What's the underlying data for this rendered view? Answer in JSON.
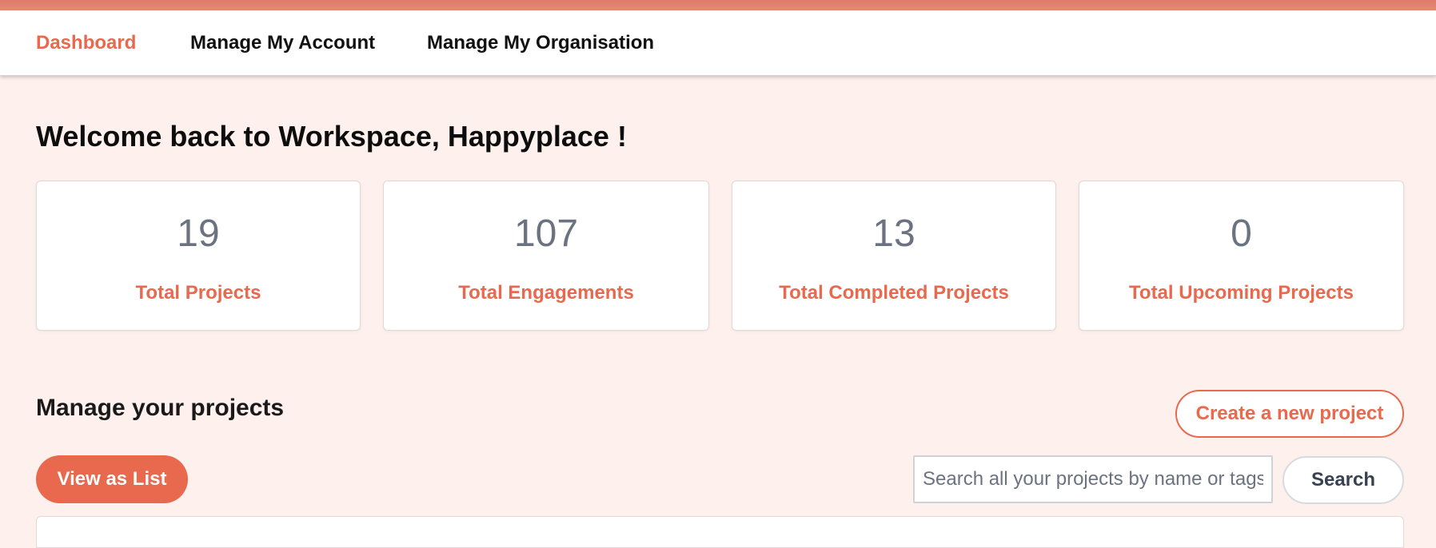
{
  "nav": {
    "items": [
      {
        "label": "Dashboard",
        "active": true
      },
      {
        "label": "Manage My Account",
        "active": false
      },
      {
        "label": "Manage My Organisation",
        "active": false
      }
    ]
  },
  "welcome": {
    "title": "Welcome back to Workspace, Happyplace !"
  },
  "stats": [
    {
      "value": "19",
      "label": "Total Projects"
    },
    {
      "value": "107",
      "label": "Total Engagements"
    },
    {
      "value": "13",
      "label": "Total Completed Projects"
    },
    {
      "value": "0",
      "label": "Total Upcoming Projects"
    }
  ],
  "projects": {
    "section_title": "Manage your projects",
    "create_label": "Create a new project",
    "view_as_list_label": "View as List",
    "search_placeholder": "Search all your projects by name or tags",
    "search_value": "",
    "search_button_label": "Search"
  },
  "colors": {
    "accent": "#e8694d",
    "page_background": "#fdf0ed",
    "top_strip": "#e07a6a",
    "stat_value": "#6b7280"
  }
}
